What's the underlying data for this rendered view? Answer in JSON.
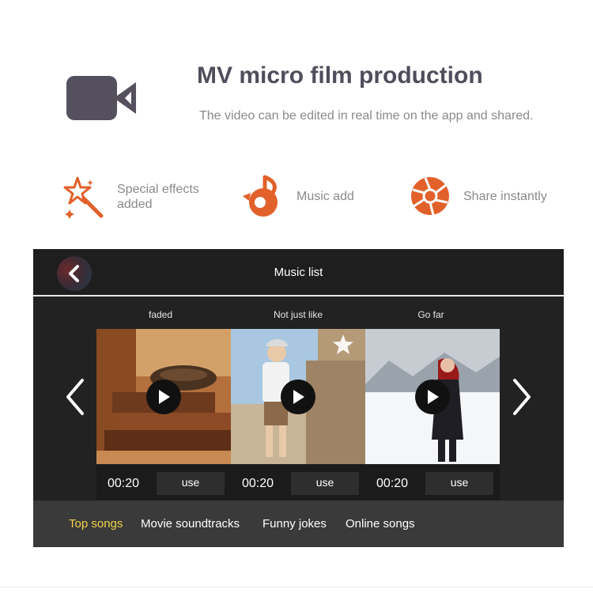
{
  "colors": {
    "accent": "#e2602a",
    "title": "#4e4e5c",
    "active_tab": "#f2d24a",
    "panel_bg": "#222222"
  },
  "header": {
    "title": "MV micro film production",
    "subtitle": "The video can be edited in real time on the app and shared.",
    "icon": "video-camera-icon"
  },
  "features": [
    {
      "label": "Special effects added",
      "icon": "magic-wand-icon"
    },
    {
      "label": "Music add",
      "icon": "music-note-icon"
    },
    {
      "label": "Share instantly",
      "icon": "aperture-icon"
    }
  ],
  "panel": {
    "title": "Music list",
    "back_icon": "back-chevron-icon",
    "songs": [
      {
        "name": "faded",
        "duration": "00:20",
        "use_label": "use"
      },
      {
        "name": "Not just like",
        "duration": "00:20",
        "use_label": "use"
      },
      {
        "name": "Go far",
        "duration": "00:20",
        "use_label": "use"
      }
    ],
    "tabs": [
      {
        "label": "Top songs",
        "active": true
      },
      {
        "label": "Movie soundtracks",
        "active": false
      },
      {
        "label": "Funny jokes",
        "active": false
      },
      {
        "label": "Online songs",
        "active": false
      }
    ]
  }
}
